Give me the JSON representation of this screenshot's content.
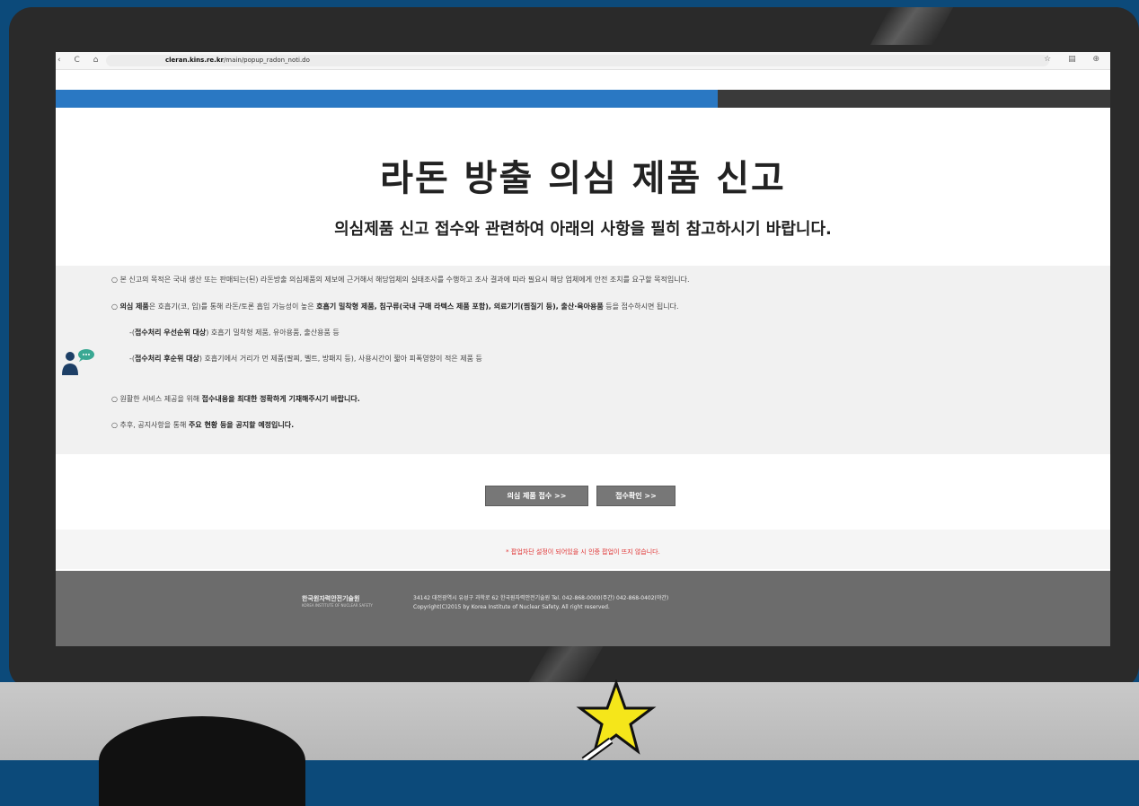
{
  "browser": {
    "url_domain": "cleran.kins.re.kr",
    "url_path": "/main/popup_radon_noti.do",
    "nav_icons": "‹ C ⌂",
    "right_icons": "☆ ▤ ⊕"
  },
  "page": {
    "progress_fraction": 0.628,
    "title": "라돈 방출 의심 제품 신고",
    "subtitle": "의심제품 신고 접수와 관련하여 아래의 사항을 필히 참고하시기 바랍니다."
  },
  "notices": {
    "l1": "○ 본 신고의 목적은 국내 생산 또는 판매되는(된) 라돈방출 의심제품의 제보에 근거해서 해당업체의 실태조사를 수행하고 조사 결과에 따라 필요시 해당 업체에게 안전 조치를 요구할 목적입니다.",
    "l2_a": "○ ",
    "l2_b": "의심 제품",
    "l2_c": "은 호흡기(코, 입)를 통해 라돈/토론 흡입 가능성이 높은 ",
    "l2_d": "호흡기 밀착형 제품, 침구류(국내 구매 라텍스 제품 포함), 의료기기(찜질기 등), 출산·육아용품",
    "l2_e": " 등을 접수하시면 됩니다.",
    "l3_a": "-(",
    "l3_b": "접수처리 우선순위 대상",
    "l3_c": ") 호흡기 밀착형 제품, 유아용품, 출산용품 등",
    "l4_a": "-(",
    "l4_b": "접수처리 후순위 대상",
    "l4_c": ") 호흡기에서 거리가 먼 제품(팔찌, 벨트, 방패지 등), 사용시간이 짧아 피폭영향이 적은 제품 등",
    "l5_a": "○ 원활한 서비스 제공을 위해 ",
    "l5_b": "접수내용을 최대한 정확하게 기재해주시기 바랍니다.",
    "l6_a": "○ 추후, 공지사항을 통해 ",
    "l6_b": "주요 현황 등을 공지할 예정입니다."
  },
  "buttons": {
    "report": "의심 제품 접수 >>",
    "check": "접수확인 >>"
  },
  "warning": "* 팝업차단 설정이 되어있을 시 인증 팝업이 뜨지 않습니다.",
  "footer": {
    "org_name": "한국원자력안전기술원",
    "org_name_en": "KOREA INSTITUTE OF NUCLEAR SAFETY",
    "address": "34142 대전광역시 유성구 과학로 62 한국원자력안전기술원 Tel. 042-868-0000(주간) 042-868-0402(야간)",
    "copyright": "Copyright(C)2015 by Korea Institute of Nuclear Safety. All right reserved."
  },
  "colors": {
    "accent_blue": "#2a78c3",
    "warning_red": "#e03030",
    "button_gray": "#777777"
  }
}
